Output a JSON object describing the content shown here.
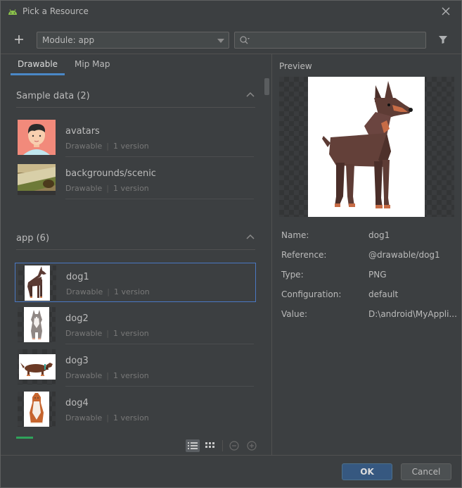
{
  "window": {
    "title": "Pick a Resource"
  },
  "toolbar": {
    "module_value": "Module: app",
    "search_placeholder": ""
  },
  "tabs": [
    {
      "label": "Drawable",
      "active": true
    },
    {
      "label": "Mip Map",
      "active": false
    }
  ],
  "sections": [
    {
      "label": "Sample data (2)",
      "items": [
        {
          "name": "avatars",
          "type": "Drawable",
          "versions": "1 version"
        },
        {
          "name": "backgrounds/scenic",
          "type": "Drawable",
          "versions": "1 version"
        }
      ]
    },
    {
      "label": "app (6)",
      "items": [
        {
          "name": "dog1",
          "type": "Drawable",
          "versions": "1 version",
          "selected": true
        },
        {
          "name": "dog2",
          "type": "Drawable",
          "versions": "1 version"
        },
        {
          "name": "dog3",
          "type": "Drawable",
          "versions": "1 version"
        },
        {
          "name": "dog4",
          "type": "Drawable",
          "versions": "1 version"
        }
      ]
    }
  ],
  "preview": {
    "label": "Preview",
    "properties": [
      {
        "key": "Name:",
        "value": "dog1"
      },
      {
        "key": "Reference:",
        "value": "@drawable/dog1"
      },
      {
        "key": "Type:",
        "value": "PNG"
      },
      {
        "key": "Configuration:",
        "value": "default"
      },
      {
        "key": "Value:",
        "value": "D:\\android\\MyAppli..."
      }
    ]
  },
  "footer": {
    "ok_label": "OK",
    "cancel_label": "Cancel"
  },
  "colors": {
    "accent": "#4a88c7",
    "selection_border": "#4a78c2",
    "ok_button": "#365880"
  }
}
